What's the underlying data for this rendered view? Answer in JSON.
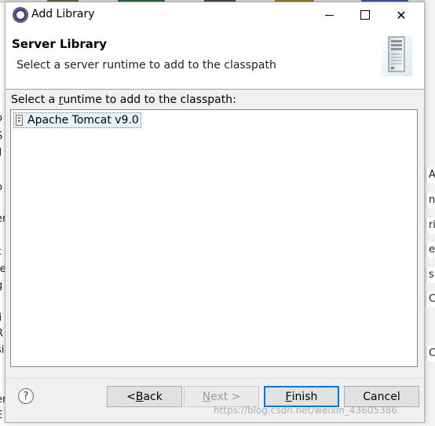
{
  "window": {
    "title": "Add Library",
    "minimize_glyph": "",
    "close_glyph": "✕"
  },
  "header": {
    "title": "Server Library",
    "subtitle": "Select a server runtime to add to the classpath"
  },
  "runtimes": {
    "label_pre": "Select a ",
    "label_accel": "r",
    "label_post": "untime to add to the classpath:",
    "items": [
      {
        "label": "Apache Tomcat v9.0",
        "selected": true,
        "icon": "server-runtime-icon"
      }
    ]
  },
  "buttons": {
    "help": "?",
    "back_pre": "< ",
    "back_accel": "B",
    "back_post": "ack",
    "next_accel": "N",
    "next_post": "ext >",
    "finish_accel": "F",
    "finish_post": "inish",
    "cancel": "Cancel"
  },
  "background": {
    "left_fragments": [
      "t",
      "o",
      "S",
      "il",
      "l",
      "o",
      "er",
      "c",
      "fe",
      "g",
      "li",
      "R",
      "si",
      "er",
      "E"
    ],
    "right_fragments": [
      "A",
      "n",
      "ri",
      "e",
      "s",
      "C",
      "C"
    ],
    "top_colors": [
      "#5e6a3c",
      "#2c6a3d",
      "#4a4a4a",
      "#9a7b2d",
      "#3b5ca8"
    ]
  },
  "watermark": "https://blog.csdn.net/weixin_43605386",
  "colors": {
    "accent": "#0078d7",
    "selection_bg": "#e5f1fb",
    "dialog_bg": "#f0f0f0"
  }
}
